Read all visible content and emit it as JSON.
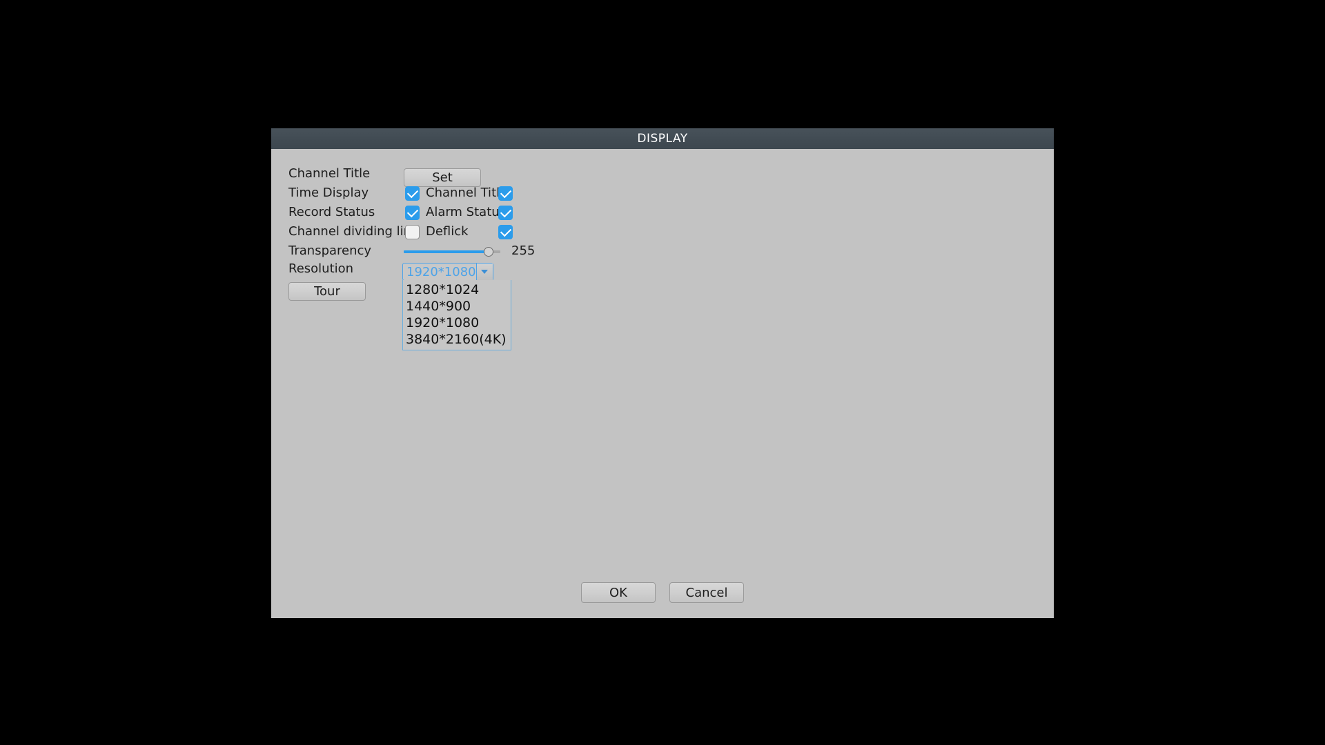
{
  "dialog": {
    "title": "DISPLAY"
  },
  "form": {
    "channel_title": {
      "label": "Channel Title",
      "set_button": "Set"
    },
    "time_display": {
      "label": "Time Display",
      "checked": true,
      "second_label": "Channel Title",
      "second_checked": true
    },
    "record_status": {
      "label": "Record Status",
      "checked": true,
      "second_label": "Alarm Status",
      "second_checked": true
    },
    "channel_dividing_line": {
      "label": "Channel dividing line",
      "checked": false,
      "second_label": "Deflick",
      "second_checked": true
    },
    "transparency": {
      "label": "Transparency",
      "value": "255"
    },
    "resolution": {
      "label": "Resolution",
      "selected": "1920*1080",
      "options": [
        "1280*1024",
        "1440*900",
        "1920*1080",
        "3840*2160(4K)"
      ]
    },
    "tour": {
      "button_label": "Tour"
    }
  },
  "footer": {
    "ok_label": "OK",
    "cancel_label": "Cancel"
  },
  "colors": {
    "accent": "#2b9ceb",
    "titlebar": "#414b53",
    "dialog_bg": "#c3c3c3",
    "combo_text": "#4da3e8"
  }
}
